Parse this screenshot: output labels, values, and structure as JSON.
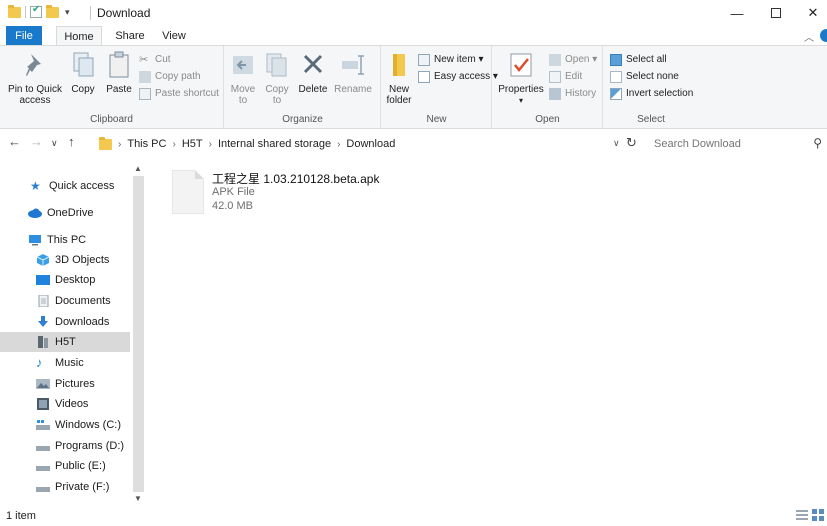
{
  "window": {
    "title": "Download",
    "minimize_symbol": "—",
    "close_symbol": "✕"
  },
  "ribbon_tabs": {
    "file": "File",
    "home": "Home",
    "share": "Share",
    "view": "View"
  },
  "ribbon": {
    "clipboard": {
      "pin_label": "Pin to Quick access",
      "copy_label": "Copy",
      "paste_label": "Paste",
      "cut_label": "Cut",
      "copy_path_label": "Copy path",
      "paste_shortcut_label": "Paste shortcut",
      "group_label": "Clipboard"
    },
    "organize": {
      "move_to_label": "Move to",
      "copy_to_label": "Copy to",
      "delete_label": "Delete",
      "rename_label": "Rename",
      "group_label": "Organize"
    },
    "new": {
      "new_folder_label": "New folder",
      "new_item_label": "New item ▾",
      "easy_access_label": "Easy access ▾",
      "group_label": "New"
    },
    "open": {
      "properties_label": "Properties",
      "open_label": "Open ▾",
      "edit_label": "Edit",
      "history_label": "History",
      "group_label": "Open"
    },
    "select": {
      "select_all_label": "Select all",
      "select_none_label": "Select none",
      "invert_selection_label": "Invert selection",
      "group_label": "Select"
    }
  },
  "address_bar": {
    "breadcrumbs": [
      "This PC",
      "H5T",
      "Internal shared storage",
      "Download"
    ],
    "search_placeholder": "Search Download"
  },
  "nav_pane": {
    "items": [
      {
        "label": "Quick access",
        "icon": "star-icon"
      },
      {
        "label": "OneDrive",
        "icon": "cloud-icon"
      },
      {
        "label": "This PC",
        "icon": "computer-icon"
      },
      {
        "label": "3D Objects",
        "icon": "cube-icon"
      },
      {
        "label": "Desktop",
        "icon": "desktop-icon"
      },
      {
        "label": "Documents",
        "icon": "document-icon"
      },
      {
        "label": "Downloads",
        "icon": "download-arrow-icon"
      },
      {
        "label": "H5T",
        "icon": "phone-icon"
      },
      {
        "label": "Music",
        "icon": "music-note-icon"
      },
      {
        "label": "Pictures",
        "icon": "pictures-icon"
      },
      {
        "label": "Videos",
        "icon": "video-icon"
      },
      {
        "label": "Windows (C:)",
        "icon": "windows-drive-icon"
      },
      {
        "label": "Programs (D:)",
        "icon": "drive-icon"
      },
      {
        "label": "Public (E:)",
        "icon": "drive-icon"
      },
      {
        "label": "Private (F:)",
        "icon": "drive-icon"
      }
    ],
    "selected": "H5T"
  },
  "files": [
    {
      "name": "工程之星 1.03.210128.beta.apk",
      "type": "APK File",
      "size": "42.0 MB"
    }
  ],
  "status_bar": {
    "item_count": "1 item"
  },
  "colors": {
    "accent": "#1979ca",
    "selection": "#d9d9d9",
    "ribbon_bg": "#f5f6f7"
  }
}
